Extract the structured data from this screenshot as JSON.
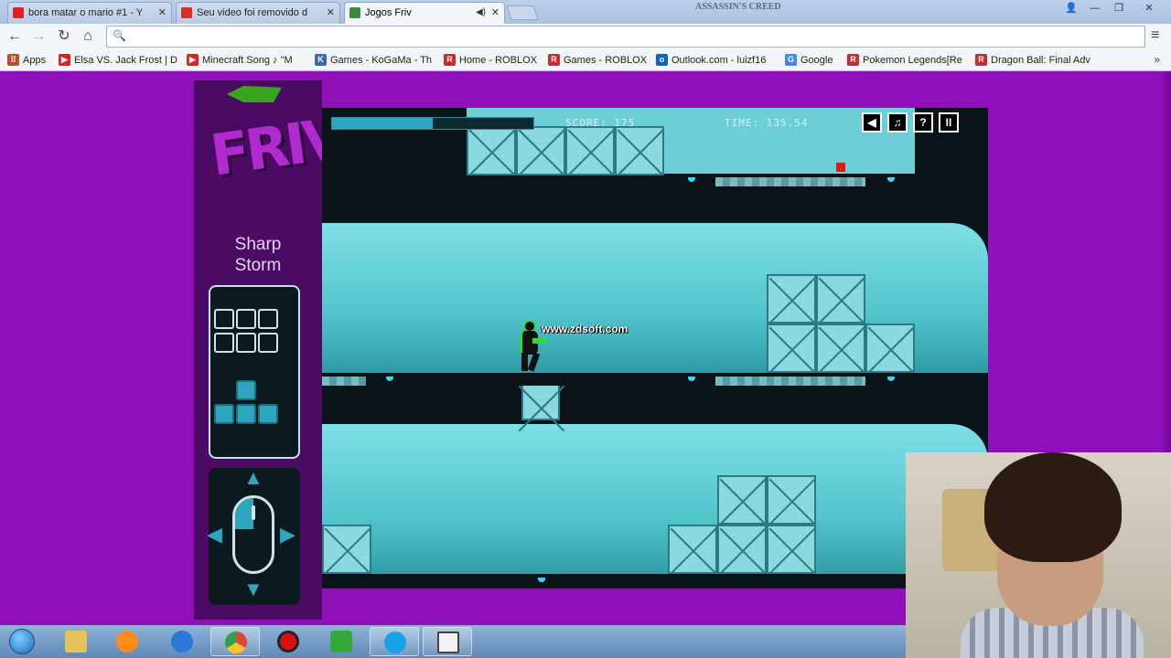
{
  "browser": {
    "tabs": [
      {
        "title": "bora matar o mario #1 - Y",
        "favicon_color": "#e02020",
        "active": false
      },
      {
        "title": "Seu video foi removido d",
        "favicon_color": "#d93025",
        "active": false
      },
      {
        "title": "Jogos Friv",
        "favicon_color": "#3a8a3a",
        "active": true
      }
    ],
    "window_brand": "ASSASSIN'S CREED",
    "bookmarks": [
      {
        "label": "Apps",
        "icon": "apps-grid-icon",
        "color": "#c04a2a"
      },
      {
        "label": "Elsa VS. Jack Frost | Di",
        "icon": "youtube-icon",
        "color": "#e02020"
      },
      {
        "label": "Minecraft Song ♪ \"M",
        "icon": "youtube-icon",
        "color": "#e02020"
      },
      {
        "label": "Games - KoGaMa - Th",
        "icon": "kogama-icon",
        "color": "#3a6ab0"
      },
      {
        "label": "Home - ROBLOX",
        "icon": "roblox-icon",
        "color": "#d0282f"
      },
      {
        "label": "Games - ROBLOX",
        "icon": "roblox-icon",
        "color": "#d0282f"
      },
      {
        "label": "Outlook.com - luizf16",
        "icon": "outlook-icon",
        "color": "#0a64c8"
      },
      {
        "label": "Google",
        "icon": "google-icon",
        "color": "#4285f4"
      },
      {
        "label": "Pokemon Legends[Re",
        "icon": "roblox-icon",
        "color": "#d0282f"
      },
      {
        "label": "Dragon Ball: Final Adv",
        "icon": "roblox-icon",
        "color": "#d0282f"
      }
    ],
    "more_bookmarks": "»"
  },
  "friv": {
    "logo": "FRIV",
    "game_title_line1": "Sharp",
    "game_title_line2": "Storm"
  },
  "game": {
    "score_label": "SCORE: 175",
    "time_label": "TIME: 135.54",
    "progress": 0.5,
    "buttons": [
      "◀",
      "♫",
      "?",
      "II"
    ],
    "watermark": "www.zdsoft.com"
  },
  "taskbar": {
    "apps": [
      {
        "name": "explorer",
        "color": "#e6c45a"
      },
      {
        "name": "media-player",
        "color": "#ff8c1a"
      },
      {
        "name": "internet-explorer",
        "color": "#2a78d8"
      },
      {
        "name": "chrome",
        "color": "#e0433a"
      },
      {
        "name": "recorder",
        "color": "#d81010"
      },
      {
        "name": "green-app",
        "color": "#35a83a"
      },
      {
        "name": "skype",
        "color": "#1aa2e8"
      },
      {
        "name": "presentation",
        "color": "#f2f2f2"
      }
    ]
  },
  "colors": {
    "page_bg": "#8f10b9",
    "game_accent": "#2ea6bd",
    "player_accent": "#2bdc3c"
  }
}
